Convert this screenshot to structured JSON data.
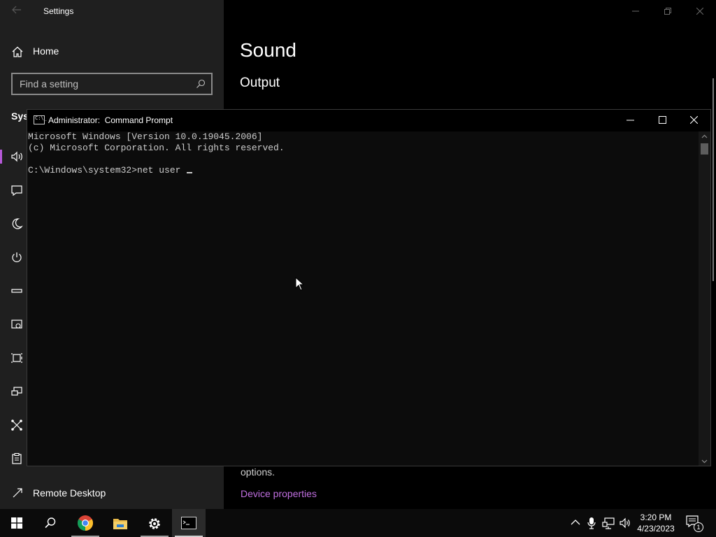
{
  "settings": {
    "window_title": "Settings",
    "home_label": "Home",
    "search_placeholder": "Find a setting",
    "section_stub": "Syst",
    "remote_desktop_label": "Remote Desktop",
    "page_title": "Sound",
    "output_heading": "Output",
    "options_text": "options.",
    "device_properties_link": "Device properties",
    "nav_icons": [
      "sound-icon",
      "display-icon",
      "focus-assist-icon",
      "power-icon",
      "storage-icon",
      "tablet-icon",
      "multitasking-icon",
      "projecting-icon",
      "shared-experiences-icon",
      "clipboard-icon"
    ],
    "accent_color": "#b659d8"
  },
  "cmd": {
    "title": "Administrator:  Command Prompt",
    "icon_text": "C:\\_",
    "lines": [
      "Microsoft Windows [Version 10.0.19045.2006]",
      "(c) Microsoft Corporation. All rights reserved.",
      "C:\\Windows\\system32>net user "
    ]
  },
  "taskbar": {
    "pinned": [
      "start-icon",
      "search-icon",
      "chrome-icon",
      "file-explorer-icon",
      "settings-icon",
      "command-prompt-icon"
    ],
    "active": "command-prompt-icon",
    "tray": [
      "chevron-up-icon",
      "microphone-icon",
      "network-icon",
      "volume-icon"
    ],
    "time": "3:20 PM",
    "date": "4/23/2023",
    "notification_count": "1"
  }
}
